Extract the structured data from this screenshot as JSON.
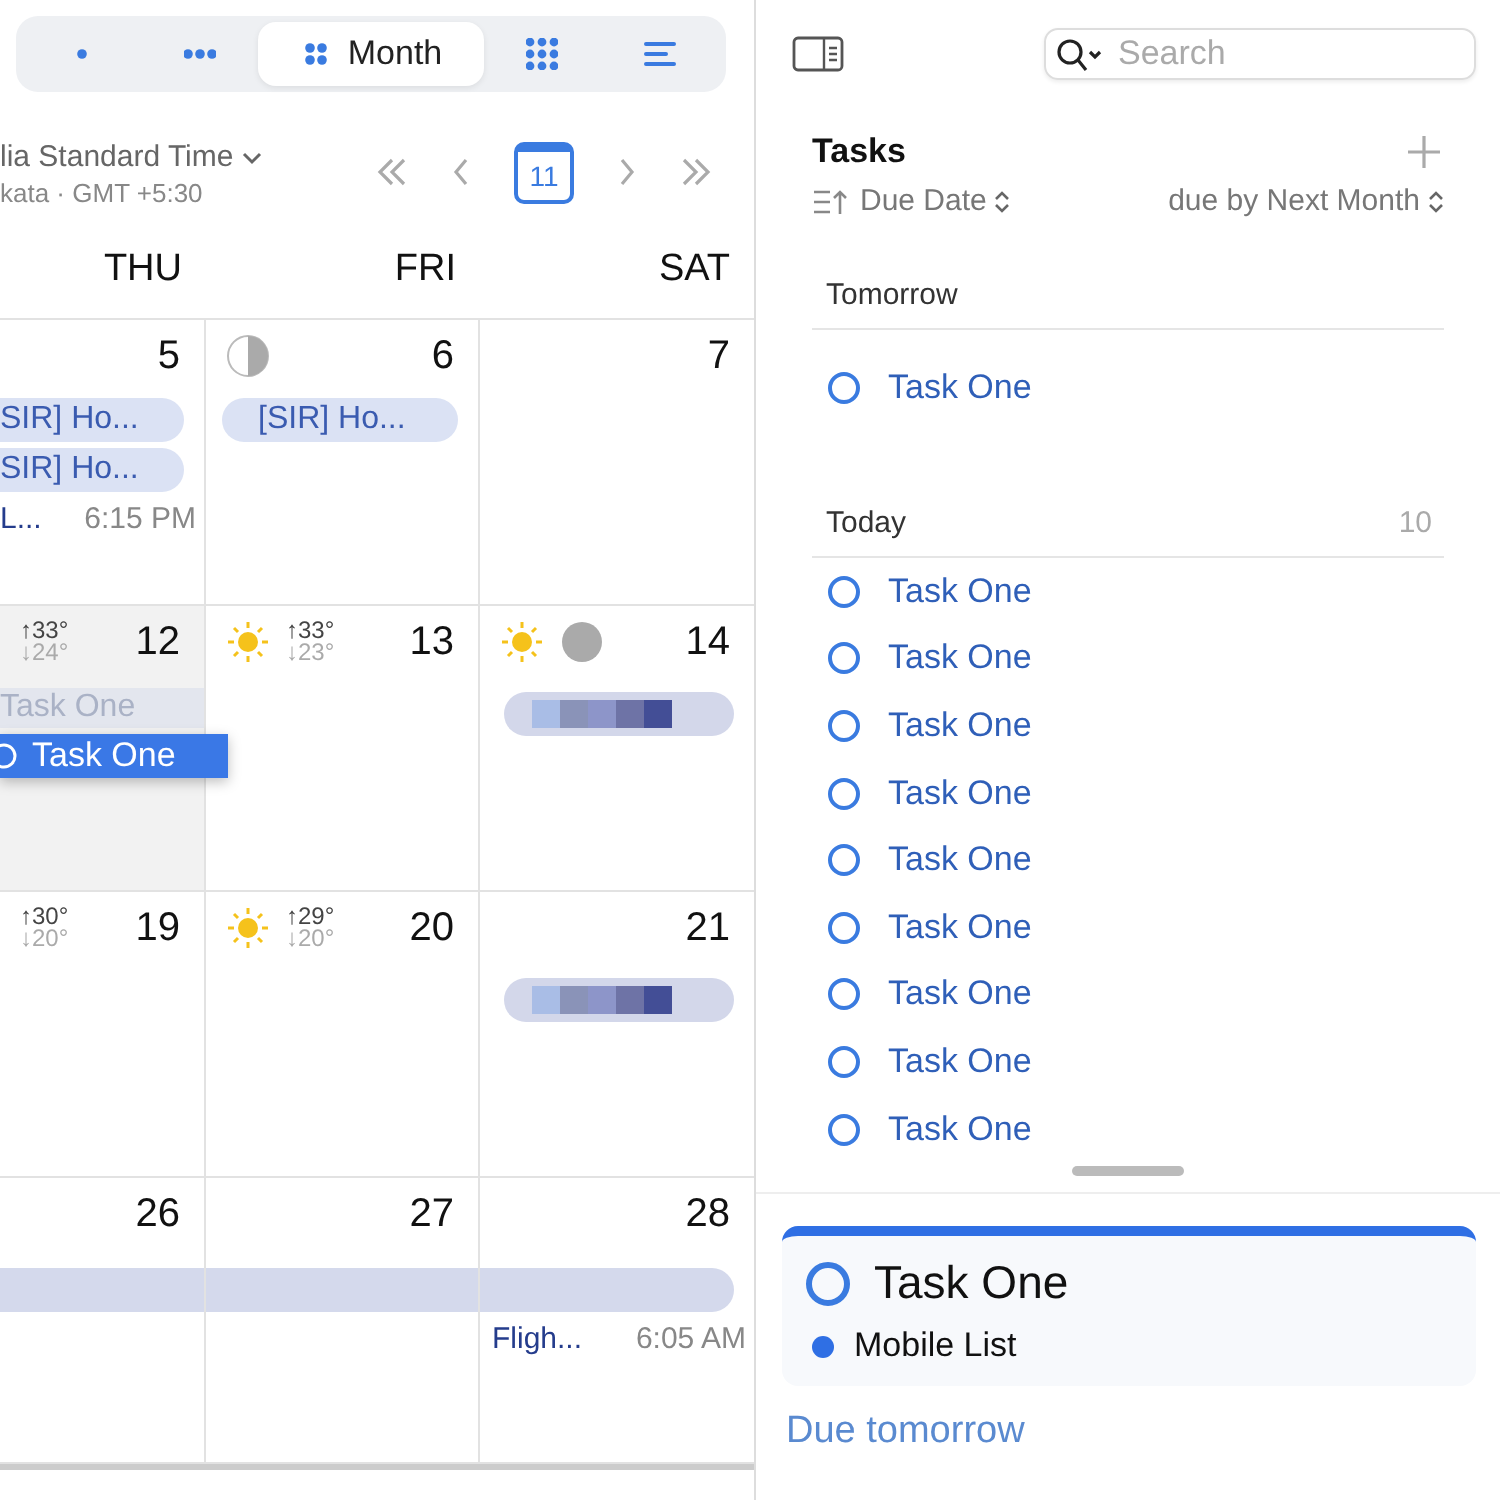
{
  "view_switcher": [
    {
      "kind": "one-dot",
      "selected": false
    },
    {
      "kind": "three-dots",
      "selected": false
    },
    {
      "kind": "four-dots",
      "label": "Month",
      "selected": true
    },
    {
      "kind": "nine-dots",
      "selected": false
    },
    {
      "kind": "lines",
      "selected": false
    }
  ],
  "timezone": {
    "name": "lia Standard Time",
    "detail": "kata · GMT +5:30"
  },
  "navigation": {
    "today": "11"
  },
  "weekdays": [
    "THU",
    "FRI",
    "SAT"
  ],
  "weeks": [
    [
      {
        "day": "5",
        "highlighted": false,
        "events": [
          {
            "kind": "pill",
            "title": "SIR] Ho..."
          },
          {
            "kind": "pill",
            "title": "SIR] Ho..."
          },
          {
            "kind": "timed",
            "title": "L...",
            "time": "6:15 PM"
          }
        ]
      },
      {
        "day": "6",
        "moon": {
          "kind": "half"
        },
        "highlighted": false,
        "events": [
          {
            "kind": "pill",
            "title": "[SIR] Ho..."
          }
        ]
      },
      {
        "day": "7",
        "highlighted": false
      }
    ],
    [
      {
        "day": "12",
        "highlighted": true,
        "weather": {
          "kind": "temps",
          "high": "↑33°",
          "low": "↓24°"
        },
        "events": [
          {
            "kind": "ghost",
            "title": "Task One"
          },
          {
            "kind": "dragged",
            "title": "Task One"
          }
        ]
      },
      {
        "day": "13",
        "highlighted": false,
        "weather": {
          "kind": "sun-temps",
          "high": "↑33°",
          "low": "↓23°"
        }
      },
      {
        "day": "14",
        "highlighted": false,
        "weather": {
          "kind": "sun"
        },
        "moon": {
          "kind": "full"
        },
        "events": [
          {
            "kind": "redacted"
          }
        ]
      }
    ],
    [
      {
        "day": "19",
        "highlighted": false,
        "weather": {
          "kind": "temps",
          "high": "↑30°",
          "low": "↓20°"
        }
      },
      {
        "day": "20",
        "highlighted": false,
        "weather": {
          "kind": "sun-temps",
          "high": "↑29°",
          "low": "↓20°"
        }
      },
      {
        "day": "21",
        "highlighted": false,
        "events": [
          {
            "kind": "redacted"
          }
        ]
      }
    ],
    [
      {
        "day": "26",
        "highlighted": false,
        "events": [
          {
            "kind": "bar"
          }
        ]
      },
      {
        "day": "27",
        "highlighted": false,
        "events": [
          {
            "kind": "bar"
          }
        ]
      },
      {
        "day": "28",
        "highlighted": false,
        "events": [
          {
            "kind": "bar-end"
          },
          {
            "kind": "timed",
            "title": "Fligh...",
            "time": "6:05 AM"
          }
        ]
      }
    ]
  ],
  "search": {
    "placeholder": "Search"
  },
  "tasks": {
    "title": "Tasks",
    "sort": "Due Date",
    "filter": "due by Next Month",
    "sections": [
      {
        "title": "Tomorrow",
        "tasks": [
          {
            "title": "Task One",
            "done": false
          }
        ]
      },
      {
        "title": "Today",
        "count": "10",
        "tasks": [
          {
            "title": "Task One",
            "done": false
          },
          {
            "title": "Task One",
            "done": false
          },
          {
            "title": "Task One",
            "done": false
          },
          {
            "title": "Task One",
            "done": false
          },
          {
            "title": "Task One",
            "done": false
          },
          {
            "title": "Task One",
            "done": false
          },
          {
            "title": "Task One",
            "done": false
          },
          {
            "title": "Task One",
            "done": false
          },
          {
            "title": "Task One",
            "done": false
          }
        ]
      }
    ]
  },
  "detail": {
    "title": "Task One",
    "done": false,
    "list": "Mobile List",
    "color": "#2f6fe4",
    "due": "Due tomorrow"
  }
}
